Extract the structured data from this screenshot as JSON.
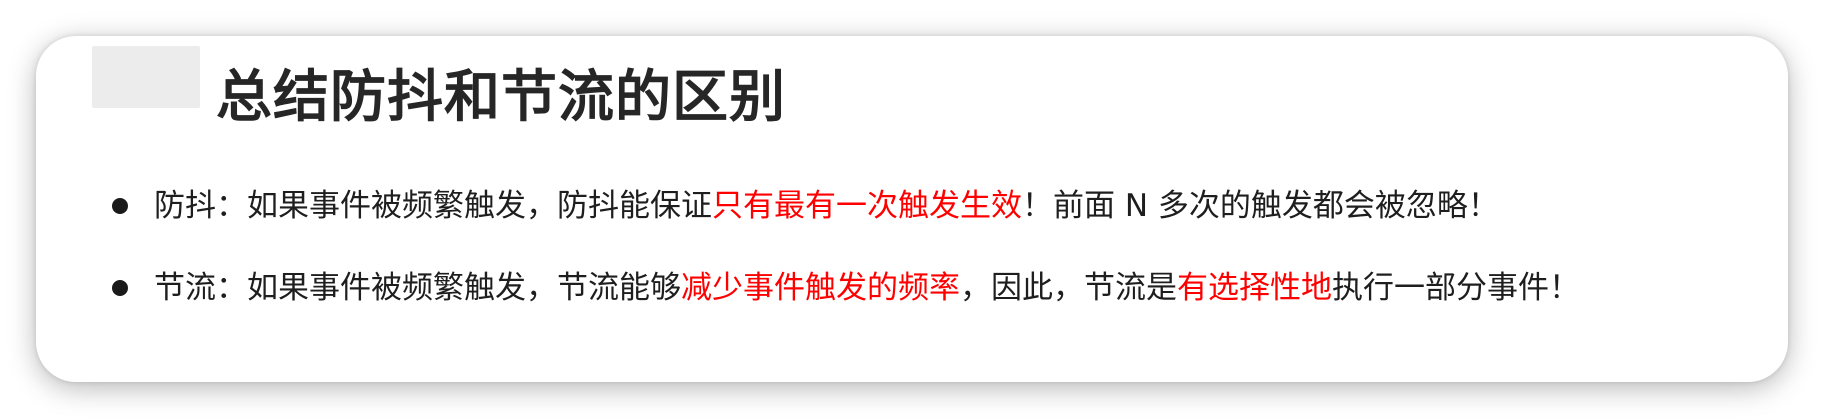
{
  "heading": "总结防抖和节流的区别",
  "items": [
    {
      "parts": [
        {
          "text": "防抖：如果事件被频繁触发，防抖能保证",
          "highlight": false
        },
        {
          "text": "只有最有一次触发生效",
          "highlight": true
        },
        {
          "text": "！前面 N 多次的触发都会被忽略！",
          "highlight": false
        }
      ]
    },
    {
      "parts": [
        {
          "text": "节流：如果事件被频繁触发，节流能够",
          "highlight": false
        },
        {
          "text": "减少事件触发的频率",
          "highlight": true
        },
        {
          "text": "，因此，节流是",
          "highlight": false
        },
        {
          "text": "有选择性地",
          "highlight": true
        },
        {
          "text": "执行一部分事件！",
          "highlight": false
        }
      ]
    }
  ],
  "colors": {
    "highlight": "#ff0000",
    "text": "#1e1e1e",
    "heading": "#262626"
  }
}
